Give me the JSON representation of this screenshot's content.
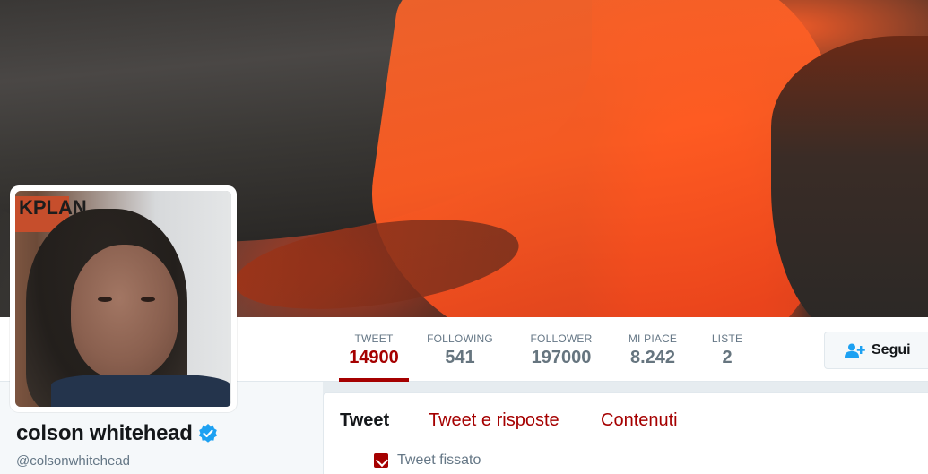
{
  "profile": {
    "name": "colson whitehead",
    "handle": "@colsonwhitehead"
  },
  "stats": [
    {
      "label": "TWEET",
      "value": "14900",
      "active": true
    },
    {
      "label": "FOLLOWING",
      "value": "541",
      "active": false
    },
    {
      "label": "FOLLOWER",
      "value": "197000",
      "active": false
    },
    {
      "label": "MI PIACE",
      "value": "8.242",
      "active": false
    },
    {
      "label": "LISTE",
      "value": "2",
      "active": false
    }
  ],
  "follow_button": {
    "label": "Segui",
    "icon": "add-user-icon"
  },
  "tabs": [
    {
      "label": "Tweet",
      "active": true
    },
    {
      "label": "Tweet e risposte",
      "active": false
    },
    {
      "label": "Contenuti",
      "active": false
    }
  ],
  "pinned": {
    "label": "Tweet fissato",
    "icon": "pin-icon"
  },
  "avatar_poster_text": "KPLAN",
  "colors": {
    "accent": "#a50000",
    "verified": "#1da1f2"
  }
}
